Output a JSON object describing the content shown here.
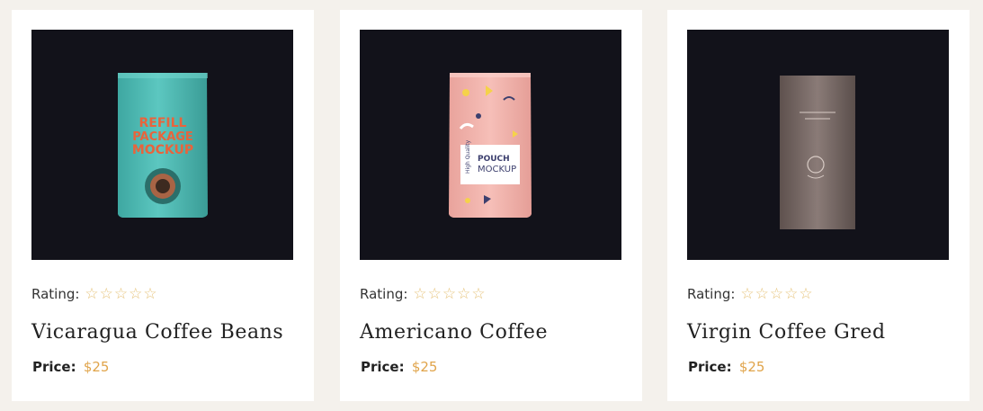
{
  "products": [
    {
      "name": "Vicaragua Coffee Beans",
      "rating_label": "Rating:",
      "price_label": "Price:",
      "price": "$25",
      "image": {
        "bag_text": [
          "REFILL",
          "PACKAGE",
          "MOCKUP"
        ],
        "bag_color": "#4fb8b2",
        "text_color": "#e8643c"
      }
    },
    {
      "name": "Americano Coffee",
      "rating_label": "Rating:",
      "price_label": "Price:",
      "price": "$25",
      "image": {
        "bag_text": [
          "POUCH",
          "MOCKUP"
        ],
        "side_text": "High Quality",
        "bag_color": "#f2b4ad"
      }
    },
    {
      "name": "Virgin Coffee Gred",
      "rating_label": "Rating:",
      "price_label": "Price:",
      "price": "$25",
      "image": {
        "bag_color": "#7d6e6a"
      }
    }
  ],
  "star_icon": "star-outline-icon",
  "colors": {
    "page_bg": "#f4f1ec",
    "accent_price": "#e0a44a",
    "star": "#e6c37a",
    "image_bg": "#12121a"
  }
}
